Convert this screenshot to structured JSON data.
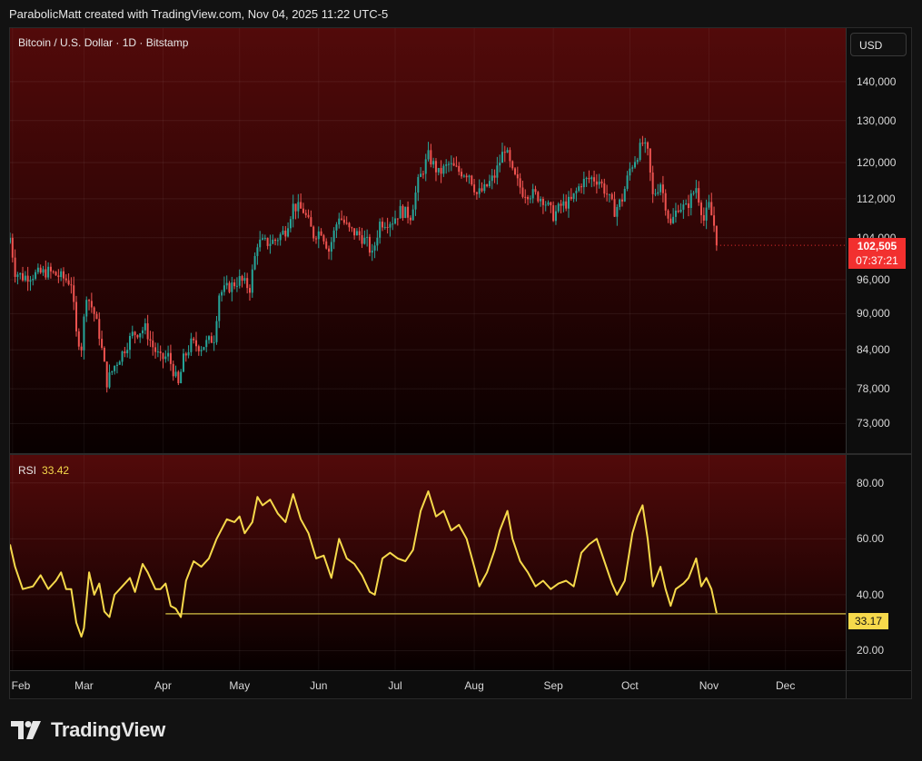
{
  "header": {
    "text": "ParabolicMatt created with TradingView.com, Nov 04, 2025 11:22 UTC-5"
  },
  "price_pane": {
    "title": "Bitcoin / U.S. Dollar · 1D · Bitstamp",
    "currency": "USD",
    "last_price": "102,505",
    "countdown": "07:37:21"
  },
  "rsi_pane": {
    "title": "RSI",
    "value": "33.42",
    "last_label": "33.17"
  },
  "brand": {
    "name": "TradingView"
  },
  "colors": {
    "up": "#26a69a",
    "down": "#ef5350",
    "rsi": "#f6d94b",
    "price_tag": "#f2302f"
  },
  "chart_data": [
    {
      "type": "candlestick",
      "title": "Bitcoin / U.S. Dollar · 1D · Bitstamp",
      "y_ticks": [
        "140,000",
        "130,000",
        "120,000",
        "112,000",
        "104,000",
        "96,000",
        "90,000",
        "84,000",
        "78,000",
        "73,000"
      ],
      "y_scale": "log",
      "ylim": [
        69000,
        155000
      ],
      "x_ticks": [
        "Feb",
        "Mar",
        "Apr",
        "May",
        "Jun",
        "Jul",
        "Aug",
        "Sep",
        "Oct",
        "Nov",
        "Dec"
      ],
      "x_start": "2025-01-31",
      "x_end": "2025-12-15",
      "close_points": [
        [
          "2025-01-31",
          104000
        ],
        [
          "2025-02-02",
          97500
        ],
        [
          "2025-02-05",
          96500
        ],
        [
          "2025-02-10",
          97000
        ],
        [
          "2025-02-15",
          97500
        ],
        [
          "2025-02-20",
          96500
        ],
        [
          "2025-02-24",
          95500
        ],
        [
          "2025-02-26",
          86500
        ],
        [
          "2025-02-28",
          84500
        ],
        [
          "2025-03-02",
          93500
        ],
        [
          "2025-03-05",
          90000
        ],
        [
          "2025-03-07",
          86500
        ],
        [
          "2025-03-10",
          79000
        ],
        [
          "2025-03-13",
          81500
        ],
        [
          "2025-03-16",
          83500
        ],
        [
          "2025-03-20",
          86500
        ],
        [
          "2025-03-25",
          87500
        ],
        [
          "2025-03-28",
          84500
        ],
        [
          "2025-03-31",
          82500
        ],
        [
          "2025-04-03",
          83000
        ],
        [
          "2025-04-07",
          78500
        ],
        [
          "2025-04-09",
          82500
        ],
        [
          "2025-04-12",
          85000
        ],
        [
          "2025-04-16",
          84500
        ],
        [
          "2025-04-21",
          86000
        ],
        [
          "2025-04-23",
          93500
        ],
        [
          "2025-04-28",
          95000
        ],
        [
          "2025-05-01",
          96000
        ],
        [
          "2025-05-05",
          94500
        ],
        [
          "2025-05-08",
          103000
        ],
        [
          "2025-05-12",
          103000
        ],
        [
          "2025-05-15",
          103500
        ],
        [
          "2025-05-19",
          105500
        ],
        [
          "2025-05-22",
          110500
        ],
        [
          "2025-05-26",
          109500
        ],
        [
          "2025-05-30",
          104500
        ],
        [
          "2025-06-02",
          105500
        ],
        [
          "2025-06-05",
          101500
        ],
        [
          "2025-06-09",
          108500
        ],
        [
          "2025-06-13",
          105500
        ],
        [
          "2025-06-17",
          104500
        ],
        [
          "2025-06-20",
          103000
        ],
        [
          "2025-06-22",
          100500
        ],
        [
          "2025-06-25",
          107000
        ],
        [
          "2025-06-30",
          107500
        ],
        [
          "2025-07-03",
          109500
        ],
        [
          "2025-07-07",
          108500
        ],
        [
          "2025-07-10",
          115500
        ],
        [
          "2025-07-14",
          121500
        ],
        [
          "2025-07-18",
          117500
        ],
        [
          "2025-07-22",
          119500
        ],
        [
          "2025-07-26",
          118000
        ],
        [
          "2025-07-30",
          117500
        ],
        [
          "2025-08-02",
          113000
        ],
        [
          "2025-08-05",
          114000
        ],
        [
          "2025-08-09",
          117000
        ],
        [
          "2025-08-13",
          123500
        ],
        [
          "2025-08-16",
          117500
        ],
        [
          "2025-08-20",
          113500
        ],
        [
          "2025-08-24",
          113000
        ],
        [
          "2025-08-28",
          112000
        ],
        [
          "2025-09-01",
          108500
        ],
        [
          "2025-09-04",
          110500
        ],
        [
          "2025-09-08",
          111500
        ],
        [
          "2025-09-12",
          115500
        ],
        [
          "2025-09-16",
          116500
        ],
        [
          "2025-09-19",
          116000
        ],
        [
          "2025-09-22",
          113000
        ],
        [
          "2025-09-25",
          109500
        ],
        [
          "2025-09-28",
          112000
        ],
        [
          "2025-10-01",
          118500
        ],
        [
          "2025-10-04",
          122000
        ],
        [
          "2025-10-06",
          124500
        ],
        [
          "2025-10-08",
          122000
        ],
        [
          "2025-10-10",
          112500
        ],
        [
          "2025-10-13",
          115500
        ],
        [
          "2025-10-16",
          108500
        ],
        [
          "2025-10-17",
          106500
        ],
        [
          "2025-10-20",
          110500
        ],
        [
          "2025-10-23",
          110000
        ],
        [
          "2025-10-27",
          114500
        ],
        [
          "2025-10-30",
          107500
        ],
        [
          "2025-11-01",
          110500
        ],
        [
          "2025-11-03",
          106500
        ],
        [
          "2025-11-04",
          102505
        ]
      ]
    },
    {
      "type": "line",
      "title": "RSI",
      "y_ticks": [
        "80.00",
        "60.00",
        "40.00",
        "20.00"
      ],
      "ylim": [
        13,
        90
      ],
      "x_start": "2025-01-31",
      "x_end": "2025-12-15",
      "reference_level": 33.17,
      "reference_start": "2025-04-02",
      "points": [
        [
          "2025-01-31",
          58
        ],
        [
          "2025-02-02",
          50
        ],
        [
          "2025-02-05",
          42
        ],
        [
          "2025-02-09",
          43
        ],
        [
          "2025-02-12",
          47
        ],
        [
          "2025-02-15",
          42
        ],
        [
          "2025-02-18",
          45
        ],
        [
          "2025-02-20",
          48
        ],
        [
          "2025-02-22",
          42
        ],
        [
          "2025-02-24",
          42
        ],
        [
          "2025-02-26",
          30
        ],
        [
          "2025-02-28",
          25
        ],
        [
          "2025-03-01",
          28
        ],
        [
          "2025-03-03",
          48
        ],
        [
          "2025-03-05",
          40
        ],
        [
          "2025-03-07",
          44
        ],
        [
          "2025-03-09",
          34
        ],
        [
          "2025-03-11",
          32
        ],
        [
          "2025-03-13",
          40
        ],
        [
          "2025-03-16",
          43
        ],
        [
          "2025-03-19",
          46
        ],
        [
          "2025-03-21",
          41
        ],
        [
          "2025-03-24",
          51
        ],
        [
          "2025-03-26",
          48
        ],
        [
          "2025-03-29",
          42
        ],
        [
          "2025-03-31",
          42
        ],
        [
          "2025-04-02",
          44
        ],
        [
          "2025-04-04",
          36
        ],
        [
          "2025-04-06",
          35
        ],
        [
          "2025-04-08",
          32
        ],
        [
          "2025-04-10",
          45
        ],
        [
          "2025-04-13",
          52
        ],
        [
          "2025-04-16",
          50
        ],
        [
          "2025-04-19",
          53
        ],
        [
          "2025-04-22",
          60
        ],
        [
          "2025-04-26",
          67
        ],
        [
          "2025-04-29",
          66
        ],
        [
          "2025-05-01",
          68
        ],
        [
          "2025-05-03",
          62
        ],
        [
          "2025-05-06",
          66
        ],
        [
          "2025-05-08",
          75
        ],
        [
          "2025-05-10",
          72
        ],
        [
          "2025-05-13",
          74
        ],
        [
          "2025-05-16",
          69
        ],
        [
          "2025-05-19",
          66
        ],
        [
          "2025-05-22",
          76
        ],
        [
          "2025-05-25",
          67
        ],
        [
          "2025-05-28",
          62
        ],
        [
          "2025-05-31",
          53
        ],
        [
          "2025-06-03",
          54
        ],
        [
          "2025-06-06",
          46
        ],
        [
          "2025-06-09",
          60
        ],
        [
          "2025-06-12",
          53
        ],
        [
          "2025-06-15",
          51
        ],
        [
          "2025-06-18",
          47
        ],
        [
          "2025-06-21",
          41
        ],
        [
          "2025-06-23",
          40
        ],
        [
          "2025-06-26",
          53
        ],
        [
          "2025-06-29",
          55
        ],
        [
          "2025-07-02",
          53
        ],
        [
          "2025-07-05",
          52
        ],
        [
          "2025-07-08",
          56
        ],
        [
          "2025-07-11",
          70
        ],
        [
          "2025-07-14",
          77
        ],
        [
          "2025-07-17",
          68
        ],
        [
          "2025-07-20",
          70
        ],
        [
          "2025-07-23",
          63
        ],
        [
          "2025-07-26",
          65
        ],
        [
          "2025-07-29",
          60
        ],
        [
          "2025-08-01",
          50
        ],
        [
          "2025-08-03",
          43
        ],
        [
          "2025-08-06",
          48
        ],
        [
          "2025-08-09",
          56
        ],
        [
          "2025-08-11",
          63
        ],
        [
          "2025-08-14",
          70
        ],
        [
          "2025-08-16",
          60
        ],
        [
          "2025-08-19",
          52
        ],
        [
          "2025-08-22",
          48
        ],
        [
          "2025-08-25",
          43
        ],
        [
          "2025-08-28",
          45
        ],
        [
          "2025-08-31",
          42
        ],
        [
          "2025-09-03",
          44
        ],
        [
          "2025-09-06",
          45
        ],
        [
          "2025-09-09",
          43
        ],
        [
          "2025-09-12",
          55
        ],
        [
          "2025-09-15",
          58
        ],
        [
          "2025-09-18",
          60
        ],
        [
          "2025-09-21",
          52
        ],
        [
          "2025-09-24",
          44
        ],
        [
          "2025-09-26",
          40
        ],
        [
          "2025-09-29",
          45
        ],
        [
          "2025-10-02",
          62
        ],
        [
          "2025-10-04",
          68
        ],
        [
          "2025-10-06",
          72
        ],
        [
          "2025-10-08",
          60
        ],
        [
          "2025-10-10",
          43
        ],
        [
          "2025-10-13",
          50
        ],
        [
          "2025-10-15",
          42
        ],
        [
          "2025-10-17",
          36
        ],
        [
          "2025-10-19",
          42
        ],
        [
          "2025-10-22",
          44
        ],
        [
          "2025-10-24",
          46
        ],
        [
          "2025-10-27",
          53
        ],
        [
          "2025-10-29",
          43
        ],
        [
          "2025-10-31",
          46
        ],
        [
          "2025-11-02",
          42
        ],
        [
          "2025-11-04",
          33.42
        ]
      ]
    }
  ]
}
